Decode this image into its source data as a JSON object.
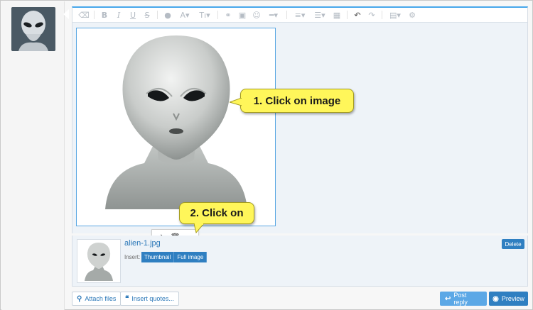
{
  "toolbar": {
    "items": [
      {
        "name": "eraser",
        "glyph": "⌫"
      },
      {
        "name": "bold",
        "glyph": "B"
      },
      {
        "name": "italic",
        "glyph": "I"
      },
      {
        "name": "underline",
        "glyph": "U"
      },
      {
        "name": "strikethrough",
        "glyph": "S"
      },
      {
        "name": "color",
        "glyph": "●"
      },
      {
        "name": "font-size",
        "glyph": "A▾"
      },
      {
        "name": "text-style",
        "glyph": "Tı▾"
      },
      {
        "name": "link",
        "glyph": "⚭"
      },
      {
        "name": "image",
        "glyph": "▣"
      },
      {
        "name": "emoji",
        "glyph": "☺"
      },
      {
        "name": "more",
        "glyph": "━▾"
      },
      {
        "name": "align",
        "glyph": "≡▾"
      },
      {
        "name": "list",
        "glyph": "☰▾"
      },
      {
        "name": "table",
        "glyph": "▦"
      },
      {
        "name": "undo",
        "glyph": "↶"
      },
      {
        "name": "redo",
        "glyph": "↷"
      },
      {
        "name": "save",
        "glyph": "▤▾"
      },
      {
        "name": "settings",
        "glyph": "⚙"
      }
    ]
  },
  "callouts": {
    "first": "1. Click on image",
    "second": "2. Click on"
  },
  "image_toolbar": {
    "swap": "⇄",
    "delete": "🗑",
    "link": "⚭"
  },
  "attachment": {
    "filename": "alien-1.jpg",
    "insert_label": "Insert:",
    "thumbnail_label": "Thumbnail",
    "full_image_label": "Full image",
    "delete_label": "Delete"
  },
  "footer": {
    "attach_label": "Attach files",
    "quotes_label": "Insert quotes...",
    "post_label": "Post reply",
    "preview_label": "Preview"
  },
  "colors": {
    "accent": "#2f7fc1",
    "callout": "#fff65a"
  }
}
